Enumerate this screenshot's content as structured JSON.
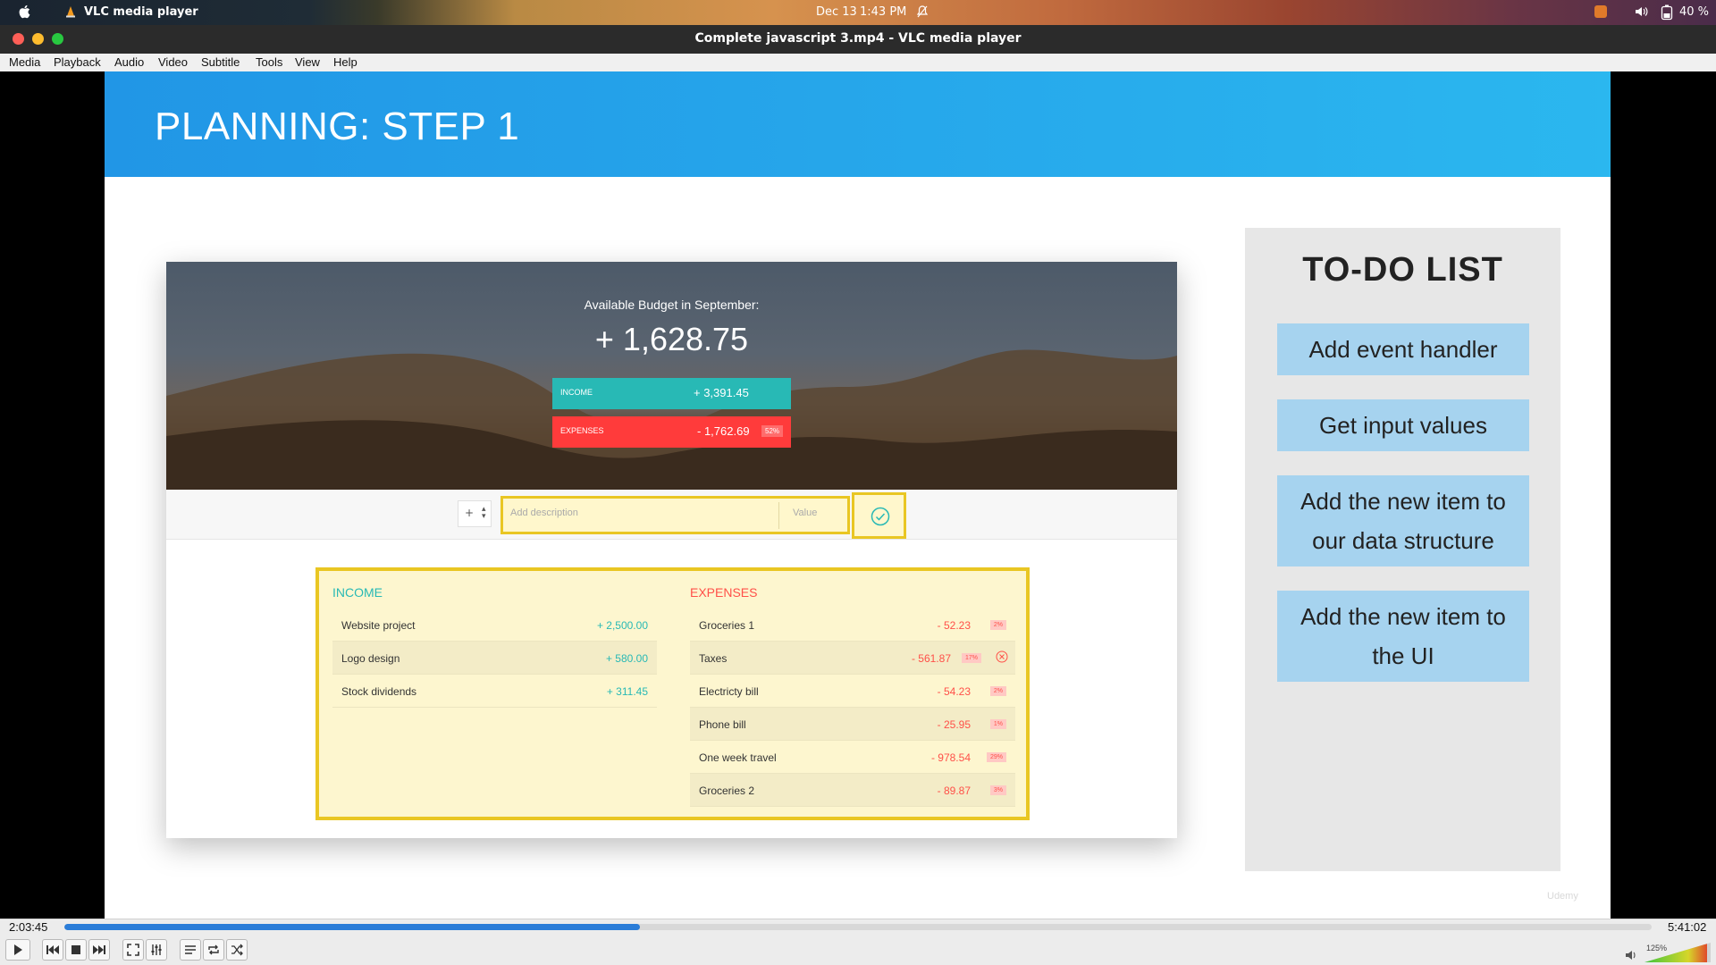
{
  "menubar_top": {
    "app_name": "VLC media player",
    "date": "Dec 13",
    "time": "1:43 PM",
    "battery": "40 %"
  },
  "window": {
    "title": "Complete javascript 3.mp4 - VLC media player"
  },
  "menu": [
    "Media",
    "Playback",
    "Audio",
    "Video",
    "Subtitle",
    "Tools",
    "View",
    "Help"
  ],
  "slide": {
    "title": "PLANNING: STEP 1",
    "budget": {
      "label": "Available Budget in September:",
      "value": "+ 1,628.75",
      "income_label": "INCOME",
      "income_value": "+ 3,391.45",
      "expenses_label": "EXPENSES",
      "expenses_value": "- 1,762.69",
      "expenses_pct": "52%"
    },
    "input": {
      "type": "+",
      "description_placeholder": "Add description",
      "value_placeholder": "Value"
    },
    "income": {
      "title": "INCOME",
      "items": [
        {
          "name": "Website project",
          "amount": "+ 2,500.00"
        },
        {
          "name": "Logo design",
          "amount": "+ 580.00"
        },
        {
          "name": "Stock dividends",
          "amount": "+ 311.45"
        }
      ]
    },
    "expenses": {
      "title": "EXPENSES",
      "items": [
        {
          "name": "Groceries 1",
          "amount": "- 52.23",
          "pct": "2%"
        },
        {
          "name": "Taxes",
          "amount": "- 561.87",
          "pct": "17%"
        },
        {
          "name": "Electricty bill",
          "amount": "- 54.23",
          "pct": "2%"
        },
        {
          "name": "Phone bill",
          "amount": "- 25.95",
          "pct": "1%"
        },
        {
          "name": "One week travel",
          "amount": "- 978.54",
          "pct": "29%"
        },
        {
          "name": "Groceries 2",
          "amount": "- 89.87",
          "pct": "3%"
        }
      ]
    },
    "todo": {
      "title": "TO-DO LIST",
      "items": [
        "Add event handler",
        "Get input values",
        "Add the new item to our data structure",
        "Add the new item to the UI"
      ]
    },
    "watermark": "Udemy"
  },
  "player": {
    "elapsed": "2:03:45",
    "total": "5:41:02",
    "progress": 0.3628,
    "volume": "125%"
  },
  "colors": {
    "accent": "#2b7dd8",
    "income": "#28b9b5",
    "expenses": "#ff5049",
    "highlight": "#e9c623",
    "todo_item": "#a6d3ef"
  }
}
